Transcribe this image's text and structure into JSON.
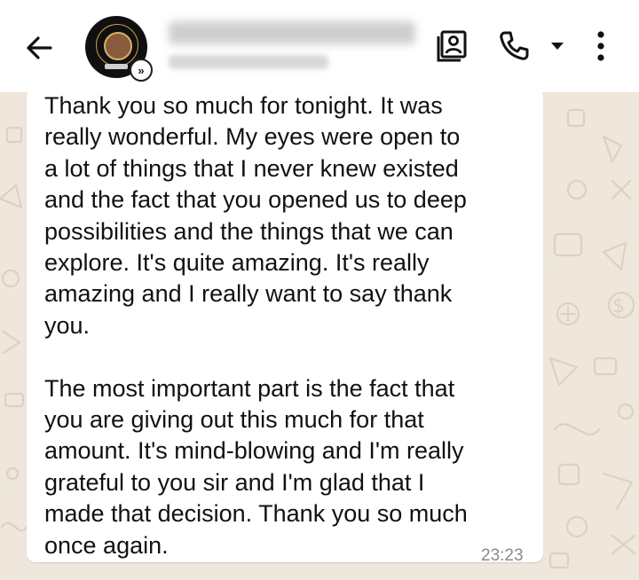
{
  "header": {
    "back_icon": "arrow-left-icon",
    "avatar_icon": "contact-avatar",
    "badge_icon": "business-chevrons-icon",
    "badge_text": "»",
    "contact_name": "",
    "subtitle": "Business Account",
    "actions": {
      "contact_card_icon": "contact-card-icon",
      "call_icon": "phone-icon",
      "call_menu_icon": "caret-down-icon",
      "more_icon": "more-vertical-icon"
    }
  },
  "chat": {
    "wallpaper": "doodle-pattern",
    "message": {
      "paragraph1": "Thank you so much for tonight. It was\nreally wonderful. My eyes were open to\na lot of things that I never knew existed\nand the fact that you opened us to deep\npossibilities and the things that we can\nexplore. It's quite amazing. It's really\namazing and I really want to say thank\nyou.",
      "paragraph2": "The most important part is the fact that\nyou are giving out this much for that\namount. It's mind-blowing and I'm really\ngrateful to you sir and I'm glad that I\nmade that decision. Thank you so much\nonce again.",
      "time": "23:23"
    }
  },
  "colors": {
    "header_bg": "#ffffff",
    "wallpaper_bg": "#efe7dc",
    "bubble_bg": "#ffffff",
    "text": "#111111",
    "time_text": "#8a8a8a"
  }
}
